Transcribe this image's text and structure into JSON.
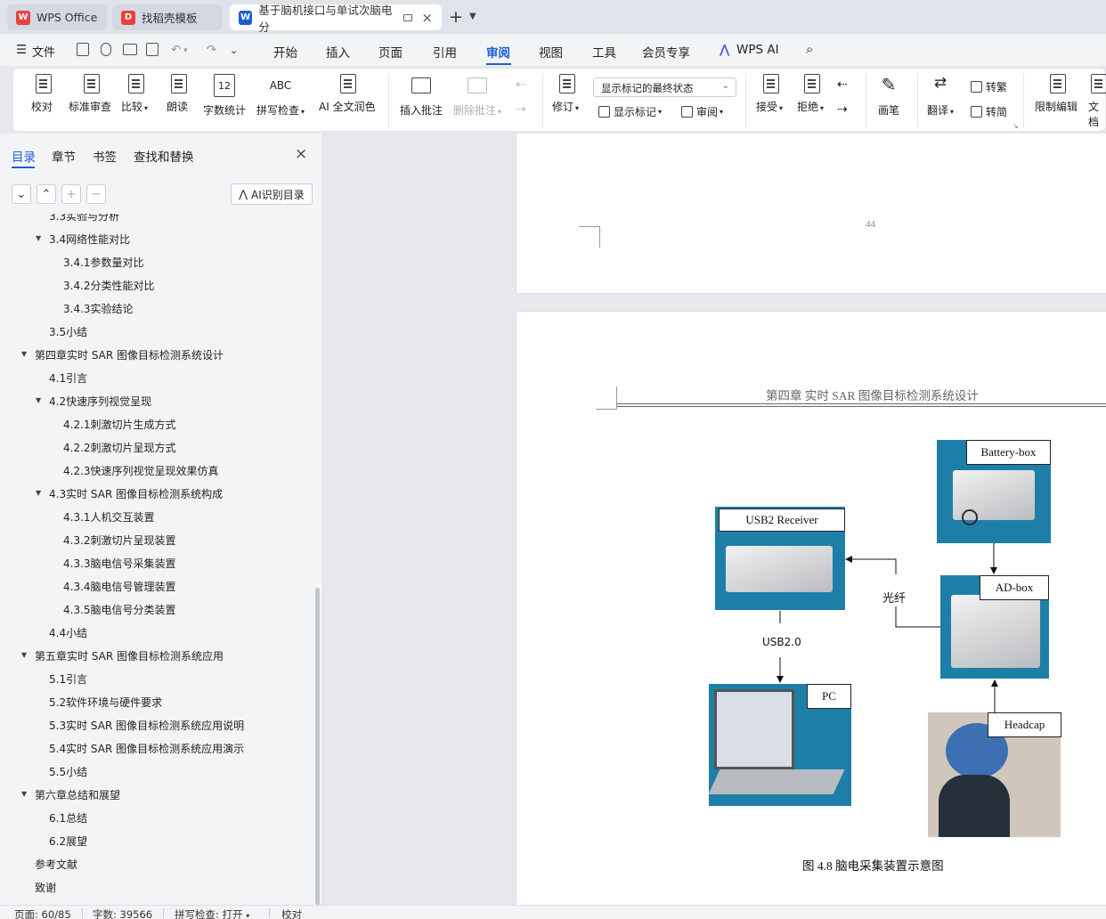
{
  "tabs": [
    {
      "label": "WPS Office",
      "logo": "W",
      "color": "#e8413c"
    },
    {
      "label": "找稻壳模板",
      "logo": "D",
      "color": "#e8413c"
    },
    {
      "label": "基于脑机接口与单试次脑电分",
      "logo": "W",
      "color": "#1a5fd6"
    }
  ],
  "menu": {
    "file": "文件",
    "items": [
      "开始",
      "插入",
      "页面",
      "引用",
      "审阅",
      "视图",
      "工具",
      "会员专享"
    ],
    "active": "审阅",
    "wps_ai": "WPS AI"
  },
  "ribbon": {
    "proofread": "校对",
    "standard_review": "标准审查",
    "compare": "比较",
    "read_aloud": "朗读",
    "word_count": "字数统计",
    "spell_check": "拼写检查",
    "ai_polish": "AI 全文润色",
    "insert_comment": "插入批注",
    "delete_comment": "删除批注",
    "track_changes": "修订",
    "markup_state": "显示标记的最终状态",
    "show_markup": "显示标记",
    "review": "审阅",
    "accept": "接受",
    "reject": "拒绝",
    "pen": "画笔",
    "translate": "翻译",
    "to_traditional": "转繁",
    "to_simplified": "转简",
    "restrict_edit": "限制编辑",
    "doc_more": "文档",
    "spell_icon_text": "ABC",
    "count_icon_text": "12"
  },
  "panel": {
    "tabs": [
      "目录",
      "章节",
      "书签",
      "查找和替换"
    ],
    "ai_toc": "AI识别目录"
  },
  "toc": [
    {
      "text": "3.3实验与分析",
      "level": 2,
      "arrow": false
    },
    {
      "text": "3.4网络性能对比",
      "level": 2,
      "arrow": true
    },
    {
      "text": "3.4.1参数量对比",
      "level": 3,
      "arrow": false
    },
    {
      "text": "3.4.2分类性能对比",
      "level": 3,
      "arrow": false
    },
    {
      "text": "3.4.3实验结论",
      "level": 3,
      "arrow": false
    },
    {
      "text": "3.5小结",
      "level": 2,
      "arrow": false
    },
    {
      "text": "第四章实时 SAR 图像目标检测系统设计",
      "level": 1,
      "arrow": true
    },
    {
      "text": "4.1引言",
      "level": 2,
      "arrow": false
    },
    {
      "text": "4.2快速序列视觉呈现",
      "level": 2,
      "arrow": true
    },
    {
      "text": "4.2.1刺激切片生成方式",
      "level": 3,
      "arrow": false
    },
    {
      "text": "4.2.2刺激切片呈现方式",
      "level": 3,
      "arrow": false
    },
    {
      "text": "4.2.3快速序列视觉呈现效果仿真",
      "level": 3,
      "arrow": false
    },
    {
      "text": "4.3实时 SAR 图像目标检测系统构成",
      "level": 2,
      "arrow": true
    },
    {
      "text": "4.3.1人机交互装置",
      "level": 3,
      "arrow": false
    },
    {
      "text": "4.3.2刺激切片呈现装置",
      "level": 3,
      "arrow": false
    },
    {
      "text": "4.3.3脑电信号采集装置",
      "level": 3,
      "arrow": false
    },
    {
      "text": "4.3.4脑电信号管理装置",
      "level": 3,
      "arrow": false
    },
    {
      "text": "4.3.5脑电信号分类装置",
      "level": 3,
      "arrow": false
    },
    {
      "text": "4.4小结",
      "level": 2,
      "arrow": false
    },
    {
      "text": "第五章实时 SAR 图像目标检测系统应用",
      "level": 1,
      "arrow": true
    },
    {
      "text": "5.1引言",
      "level": 2,
      "arrow": false
    },
    {
      "text": "5.2软件环境与硬件要求",
      "level": 2,
      "arrow": false
    },
    {
      "text": "5.3实时 SAR 图像目标检测系统应用说明",
      "level": 2,
      "arrow": false
    },
    {
      "text": "5.4实时 SAR 图像目标检测系统应用演示",
      "level": 2,
      "arrow": false
    },
    {
      "text": "5.5小结",
      "level": 2,
      "arrow": false
    },
    {
      "text": "第六章总结和展望",
      "level": 1,
      "arrow": true
    },
    {
      "text": "6.1总结",
      "level": 2,
      "arrow": false
    },
    {
      "text": "6.2展望",
      "level": 2,
      "arrow": false
    },
    {
      "text": "参考文献",
      "level": 1,
      "arrow": false
    },
    {
      "text": "致谢",
      "level": 1,
      "arrow": false
    }
  ],
  "document": {
    "page_number": "44",
    "chapter_header": "第四章  实时 SAR 图像目标检测系统设计",
    "figure": {
      "battery": "Battery-box",
      "usb_receiver": "USB2 Receiver",
      "adbox": "AD-box",
      "fiber": "光纤",
      "usb": "USB2.0",
      "pc": "PC",
      "headcap": "Headcap",
      "caption": "图 4.8  脑电采集装置示意图"
    }
  },
  "status": {
    "page": "页面: 60/85",
    "words": "字数: 39566",
    "spell": "拼写检查: 打开",
    "proof": "校对"
  }
}
